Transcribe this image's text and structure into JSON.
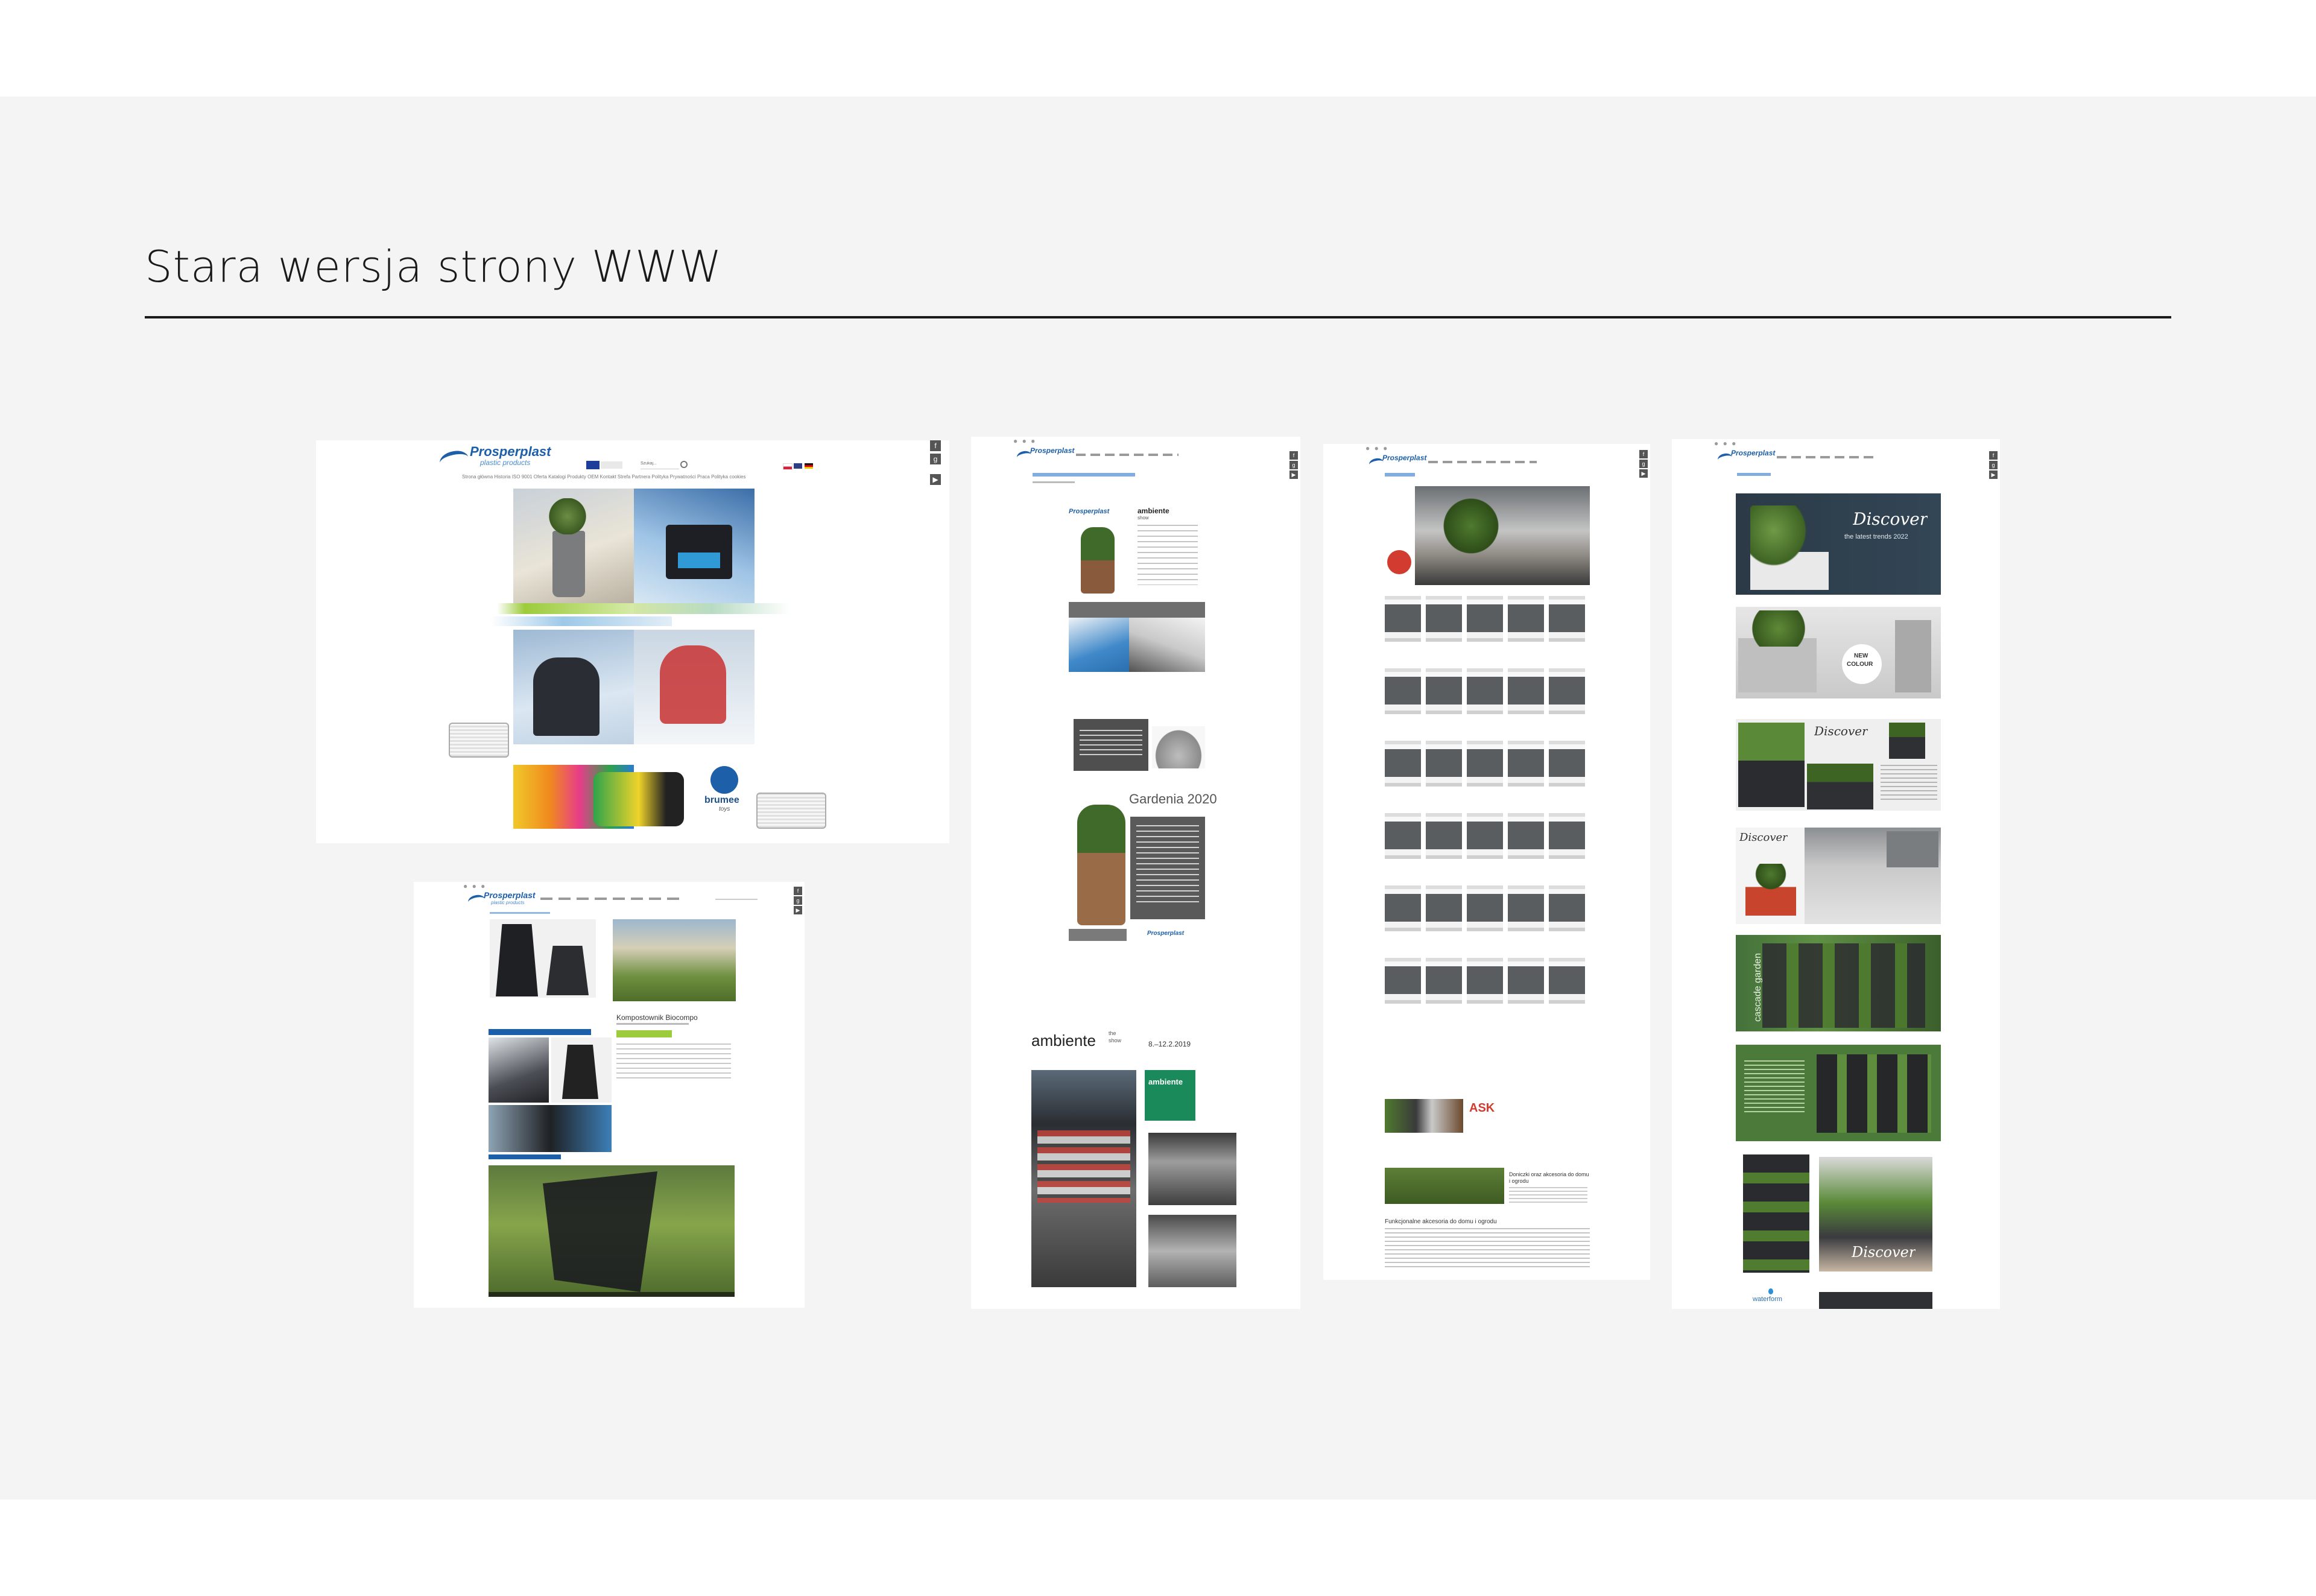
{
  "page": {
    "title": "Stara wersja strony WWW"
  },
  "colors": {
    "band": "#f4f4f4",
    "rule": "#1a1a1a",
    "brand_blue": "#1d5fa8",
    "ambiente_green": "#1a8a5a",
    "lime": "#9ccb3b"
  },
  "window_controls": "● ● ●",
  "social_icons": [
    "facebook-icon",
    "google-plus-icon",
    "youtube-icon"
  ],
  "shot1": {
    "logo": "Prosperplast",
    "logo_sub": "plastic products",
    "search_label": "Szukaj...",
    "nav": "Strona główna  Historia  ISO 9001  Oferta  Katalogi  Produkty OEM  Kontakt  Strefa Partnera  Polityka Prywatności  Praca  Polityka cookies",
    "brand_toys": "brumee",
    "brand_toys_sub": "toys"
  },
  "shot2": {
    "logo": "Prosperplast",
    "logo_sub": "plastic products",
    "product_title": "Kompostownik Biocompo"
  },
  "shot3": {
    "logo": "Prosperplast",
    "ambiente_brand": "ambiente",
    "ambiente_the": "the",
    "ambiente_show": "show",
    "gardenia": "Gardenia 2020",
    "footer_logo": "Prosperplast",
    "event_dates": "8.–12.2.2019",
    "ambiente_badge": "ambiente"
  },
  "shot4": {
    "logo": "Prosperplast",
    "badge_text": "ASK",
    "article_title": "Doniczki oraz akcesoria do domu i ogrodu",
    "section_title": "Funkcjonalne akcesoria do domu i ogrodu"
  },
  "shot5": {
    "logo": "Prosperplast",
    "discover": "Discover",
    "trends": "the latest trends 2022",
    "new_colour_1": "NEW",
    "new_colour_2": "COLOUR",
    "cascade": "cascade garden",
    "waterform": "waterform"
  }
}
